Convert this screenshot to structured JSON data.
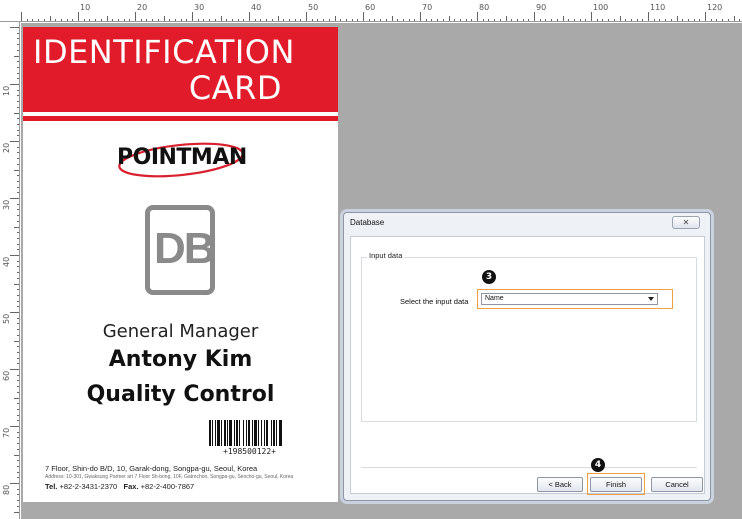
{
  "card": {
    "title_line1": "IDENTIFICATION",
    "title_line2": "CARD",
    "company_logo": "POINTMAN",
    "db_logo": "DB",
    "job_title": "General Manager",
    "person_name": "Antony Kim",
    "department": "Quality Control",
    "barcode_number": "+198500122+",
    "address_line1": "7 Floor, Shin-do B/D, 10, Garak-dong, Songpa-gu, Seoul, Korea",
    "address_line2": "Address: 10-301, Gwaksung Partner art 7 Floor Sh-bong, 10F, Gatrochon, Songpa-gu, Seocho-gu, Seoul, Korea",
    "tel_label": "Tel.",
    "tel_value": "+82-2-3431-2370",
    "fax_label": "Fax.",
    "fax_value": "+82-2-400-7867"
  },
  "colors": {
    "card_red": "#e21b2b",
    "highlight_orange": "#f0a040",
    "workspace_gray": "#a9a9a9"
  },
  "ruler": {
    "top_labels": [
      "10",
      "20",
      "30",
      "40",
      "50",
      "60",
      "70",
      "80",
      "90",
      "100",
      "110",
      "120"
    ],
    "left_labels": [
      "10",
      "20",
      "30",
      "40",
      "50",
      "60",
      "70",
      "80"
    ]
  },
  "dialog": {
    "title": "Database",
    "close_label": "✕",
    "group_label": "Input data",
    "field_label": "Select the input data",
    "select_value": "Name",
    "back_label": "< Back",
    "finish_label": "Finish",
    "cancel_label": "Cancel",
    "step_select": "3",
    "step_finish": "4"
  }
}
